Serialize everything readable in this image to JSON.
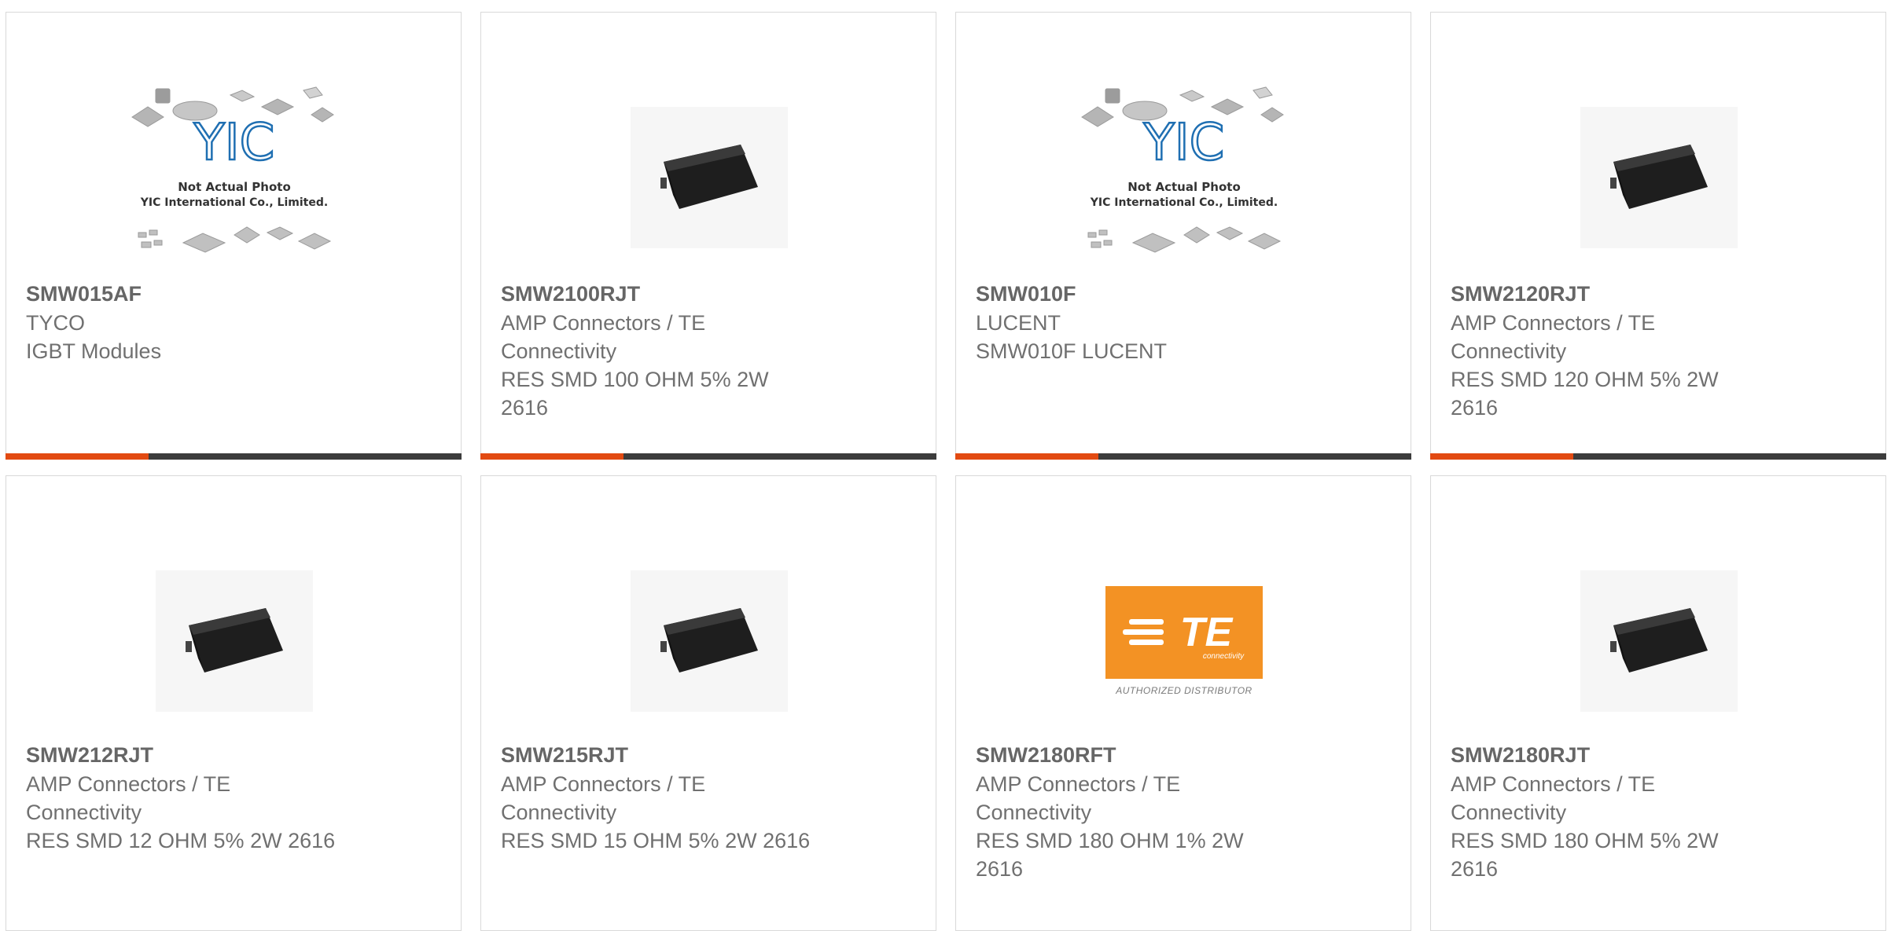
{
  "products": [
    {
      "part": "SMW015AF",
      "lines": [
        "TYCO",
        "IGBT Modules"
      ],
      "image": "yic-placeholder-icon"
    },
    {
      "part": "SMW2100RJT",
      "lines": [
        "AMP Connectors / TE",
        "Connectivity",
        "RES SMD 100 OHM 5% 2W",
        "2616"
      ],
      "image": "smd-resistor-icon"
    },
    {
      "part": "SMW010F",
      "lines": [
        "LUCENT",
        "SMW010F LUCENT"
      ],
      "image": "yic-placeholder-icon"
    },
    {
      "part": "SMW2120RJT",
      "lines": [
        "AMP Connectors / TE",
        "Connectivity",
        "RES SMD 120 OHM 5% 2W",
        "2616"
      ],
      "image": "smd-resistor-icon"
    },
    {
      "part": "SMW212RJT",
      "lines": [
        "AMP Connectors / TE",
        "Connectivity",
        "RES SMD 12 OHM 5% 2W 2616"
      ],
      "image": "smd-resistor-icon"
    },
    {
      "part": "SMW215RJT",
      "lines": [
        "AMP Connectors / TE",
        "Connectivity",
        "RES SMD 15 OHM 5% 2W 2616"
      ],
      "image": "smd-resistor-icon"
    },
    {
      "part": "SMW2180RFT",
      "lines": [
        "AMP Connectors / TE",
        "Connectivity",
        "RES SMD 180 OHM 1% 2W",
        "2616"
      ],
      "image": "te-logo-icon"
    },
    {
      "part": "SMW2180RJT",
      "lines": [
        "AMP Connectors / TE",
        "Connectivity",
        "RES SMD 180 OHM 5% 2W",
        "2616"
      ],
      "image": "smd-resistor-icon"
    }
  ],
  "placeholder": {
    "brand": "YIC",
    "line1": "Not Actual Photo",
    "line2": "YIC International Co., Limited."
  },
  "te_logo": {
    "mark": "TE",
    "sub": "connectivity",
    "caption": "AUTHORIZED DISTRIBUTOR"
  },
  "colors": {
    "accent": "#e24a12",
    "bar": "#3c3c3c",
    "te_orange": "#f39224"
  }
}
